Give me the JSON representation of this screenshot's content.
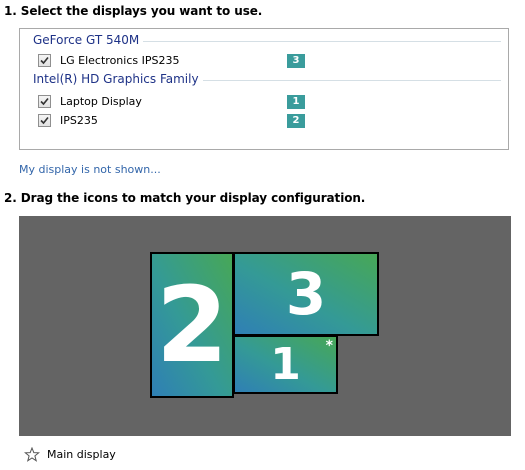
{
  "step1": {
    "title": "1. Select the displays you want to use."
  },
  "groups": [
    {
      "name": "GeForce GT 540M",
      "displays": [
        {
          "label": "LG Electronics IPS235",
          "checked": true,
          "badge": "3"
        }
      ]
    },
    {
      "name": "Intel(R) HD Graphics Family",
      "displays": [
        {
          "label": "Laptop Display",
          "checked": true,
          "badge": "1"
        },
        {
          "label": "IPS235",
          "checked": true,
          "badge": "2"
        }
      ]
    }
  ],
  "link": {
    "label": "My display is not shown..."
  },
  "step2": {
    "title": "2. Drag the icons to match your display configuration."
  },
  "monitors": [
    {
      "number": "2",
      "main": false
    },
    {
      "number": "3",
      "main": false
    },
    {
      "number": "1",
      "main": true,
      "marker": "*"
    }
  ],
  "legend": {
    "label": "Main display",
    "icon": "star-icon"
  },
  "colors": {
    "badge": "#3a9c9c",
    "group_header": "#1e3287",
    "link": "#3366aa",
    "arrangement_background": "#646464"
  }
}
